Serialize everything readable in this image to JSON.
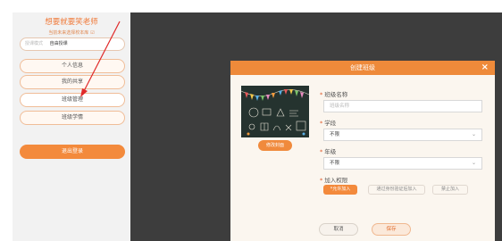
{
  "sidebar": {
    "user_name": "想要就要笑老师",
    "school_text": "当前未来选择校本库",
    "school_check": "☑",
    "mode_label": "授课模式",
    "mode_value": "自由授课",
    "menu": [
      {
        "label": "个人信息"
      },
      {
        "label": "我的共享"
      },
      {
        "label": "班级管理"
      },
      {
        "label": "班级学情"
      }
    ],
    "logout_label": "退出登录"
  },
  "modal": {
    "title": "创建班级",
    "close": "×",
    "change_cover": "修改封面",
    "class_name_label": "班级名称",
    "class_name_placeholder": "班级名称",
    "stage_label": "学段",
    "stage_value": "不限",
    "grade_label": "年级",
    "grade_value": "不限",
    "permission_label": "加入权限",
    "permissions": [
      "允许加入",
      "通过身份验证后加入",
      "禁止加入"
    ],
    "cancel_label": "取消",
    "save_label": "保存",
    "required_mark": "*"
  },
  "colors": {
    "accent": "#ee8a3a",
    "overlay": "#3d3d3d",
    "sidebar_bg": "#f2f2f2",
    "modal_bg": "#fbf6ef"
  },
  "icons": {
    "close": "close-icon",
    "chevron": "chevron-down-icon",
    "arrow": "annotation-arrow"
  }
}
